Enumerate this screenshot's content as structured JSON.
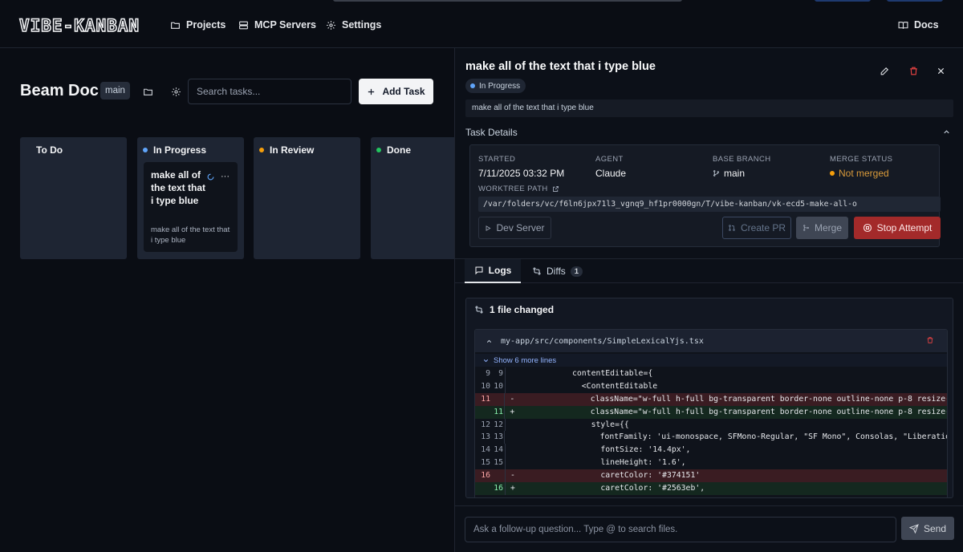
{
  "app": {
    "logo": "VIBE-KANBAN",
    "nav": [
      {
        "label": "Projects",
        "icon": "folder-icon"
      },
      {
        "label": "MCP Servers",
        "icon": "server-icon"
      },
      {
        "label": "Settings",
        "icon": "gear-icon"
      }
    ],
    "docs_label": "Docs"
  },
  "board": {
    "project_name": "Beam Doc",
    "branch": "main",
    "search_placeholder": "Search tasks...",
    "add_task_label": "Add Task",
    "columns": [
      {
        "name": "To Do",
        "color": ""
      },
      {
        "name": "In Progress",
        "color": "#60a5fa"
      },
      {
        "name": "In Review",
        "color": "#f59e0b"
      },
      {
        "name": "Done",
        "color": "#22c55e"
      }
    ],
    "card": {
      "title": "make all of the text that i type blue",
      "description": "make all of the text that i type blue",
      "more": "···"
    }
  },
  "task": {
    "title": "make all of the text that i type blue",
    "status": "In Progress",
    "description": "make all of the text that i type blue",
    "section_label": "Task Details",
    "details": {
      "started_label": "STARTED",
      "started_value": "7/11/2025 03:32 PM",
      "agent_label": "AGENT",
      "agent_value": "Claude",
      "base_branch_label": "BASE BRANCH",
      "base_branch_value": "main",
      "merge_status_label": "MERGE STATUS",
      "merge_status_value": "Not merged",
      "worktree_label": "WORKTREE PATH",
      "worktree_path": "/var/folders/vc/f6ln6jpx71l3_vgnq9_hf1pr0000gn/T/vibe-kanban/vk-ecd5-make-all-o"
    },
    "buttons": {
      "dev_server": "Dev Server",
      "create_pr": "Create PR",
      "merge": "Merge",
      "stop_attempt": "Stop Attempt"
    },
    "tabs": {
      "logs": "Logs",
      "diffs": "Diffs",
      "diffs_count": "1"
    },
    "diff": {
      "summary": "1 file changed",
      "file_path": "my-app/src/components/SimpleLexicalYjs.tsx",
      "show_more": "Show 6 more lines",
      "lines": [
        {
          "type": "ctx",
          "old": "9",
          "new": "9",
          "sign": "",
          "text": "          contentEditable={"
        },
        {
          "type": "ctx",
          "old": "10",
          "new": "10",
          "sign": "",
          "text": "            <ContentEditable"
        },
        {
          "type": "del",
          "old": "11",
          "new": "",
          "sign": "-",
          "text": "              className=\"w-full h-full bg-transparent border-none outline-none p-8 resize-n"
        },
        {
          "type": "add",
          "old": "",
          "new": "11",
          "sign": "+",
          "text": "              className=\"w-full h-full bg-transparent border-none outline-none p-8 resize-n"
        },
        {
          "type": "ctx",
          "old": "12",
          "new": "12",
          "sign": "",
          "text": "              style={{"
        },
        {
          "type": "ctx",
          "old": "13",
          "new": "13",
          "sign": "",
          "text": "                fontFamily: 'ui-monospace, SFMono-Regular, \"SF Mono\", Consolas, \"Liberation"
        },
        {
          "type": "ctx",
          "old": "14",
          "new": "14",
          "sign": "",
          "text": "                fontSize: '14.4px',"
        },
        {
          "type": "ctx",
          "old": "15",
          "new": "15",
          "sign": "",
          "text": "                lineHeight: '1.6',"
        },
        {
          "type": "del",
          "old": "16",
          "new": "",
          "sign": "-",
          "text": "                caretColor: '#374151'"
        },
        {
          "type": "add",
          "old": "",
          "new": "16",
          "sign": "+",
          "text": "                caretColor: '#2563eb',"
        }
      ]
    },
    "followup_placeholder": "Ask a follow-up question... Type @ to search files.",
    "send_label": "Send"
  },
  "colors": {
    "not_merged": "#f59e0b",
    "status_dot": "#60a5fa",
    "stop": "#a32a2a"
  }
}
